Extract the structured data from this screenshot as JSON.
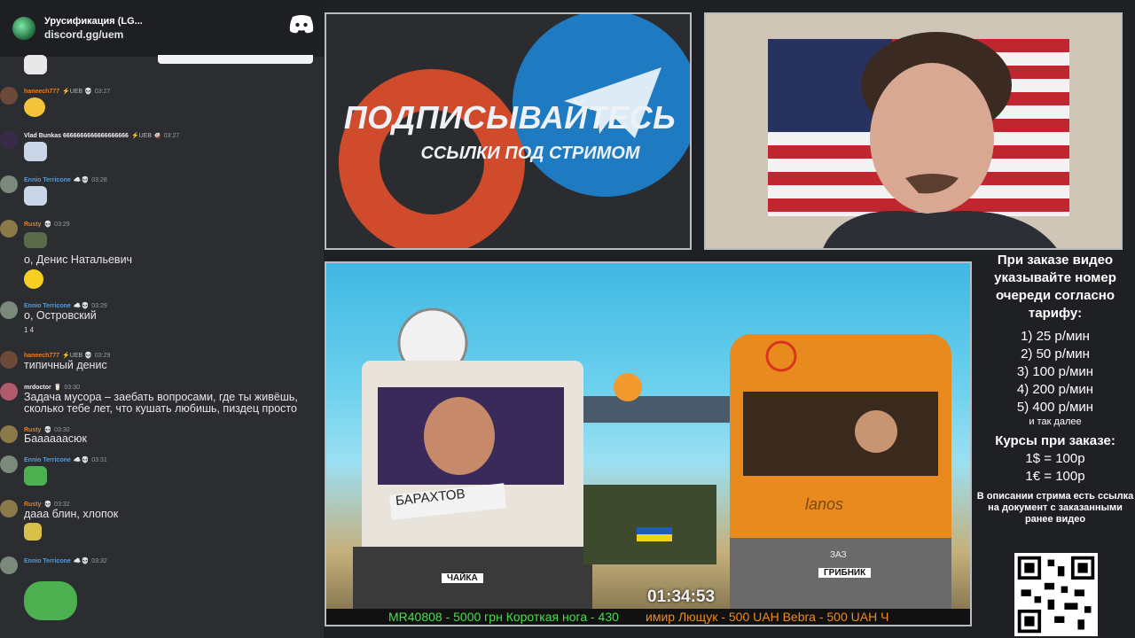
{
  "discord": {
    "server_name": "Урусификация (LG...",
    "invite": "discord.gg/uem"
  },
  "chat": [
    {
      "user": "haneech777",
      "badge": "⚡UEB 💀",
      "time": "03:27",
      "name_color": "#e67e22",
      "text": ""
    },
    {
      "user": "Vlad Bunkas 6666666666666666666",
      "badge": "⚡UEB 🥥",
      "time": "03:27",
      "name_color": "#f0f0f0",
      "text": ""
    },
    {
      "user": "Ennio Terricone",
      "badge": "☁️💀",
      "time": "03:28",
      "name_color": "#5b9bd5",
      "text": ""
    },
    {
      "user": "Rusty",
      "badge": "💀",
      "time": "03:29",
      "name_color": "#e67e22",
      "text": "о, Денис Натальевич"
    },
    {
      "user": "Ennio Terricone",
      "badge": "☁️💀",
      "time": "03:29",
      "name_color": "#5b9bd5",
      "text": "о, Островский",
      "reactions": "1  4"
    },
    {
      "user": "haneech777",
      "badge": "⚡UEB 💀",
      "time": "03:29",
      "name_color": "#e67e22",
      "text": "типичный денис"
    },
    {
      "user": "mrdoctor",
      "badge": "🥛",
      "time": "03:30",
      "name_color": "#f0f0f0",
      "text": "Задача мусора – заебать вопросами, где ты живёшь,",
      "text2": "сколько тебе лет, что кушать любишь, пиздец просто"
    },
    {
      "user": "Rusty",
      "badge": "💀",
      "time": "03:30",
      "name_color": "#e67e22",
      "text": "Баааааасюк"
    },
    {
      "user": "Ennio Terricone",
      "badge": "☁️💀",
      "time": "03:31",
      "name_color": "#5b9bd5",
      "text": ""
    },
    {
      "user": "Rusty",
      "badge": "💀",
      "time": "03:32",
      "name_color": "#e67e22",
      "text": "дааа блин, хлопок"
    },
    {
      "user": "Ennio Terricone",
      "badge": "☁️💀",
      "time": "03:32",
      "name_color": "#5b9bd5",
      "text": ""
    }
  ],
  "promo": {
    "headline": "ПОДПИСЫВАЙТЕСЬ",
    "subline": "ССЫЛКИ ПОД СТРИМОМ"
  },
  "video": {
    "timer": "01:34:53",
    "ticker_green": "MR40808 - 5000 грн  Короткая нога - 430",
    "ticker_orange": "имир Лющук - 500 UAH    Bebra - 500 UAH   Ч",
    "sign_left": "БАРАХТОВ",
    "plate_left": "ЧАЙКА",
    "plate_right": "ГРИБНИК",
    "bus_brand": "lanos",
    "bus_badge": "ЗАЗ"
  },
  "info": {
    "order_note": "При заказе видео указывайте номер очереди согласно тарифу:",
    "tariffs": [
      "1) 25 р/мин",
      "2) 50 р/мин",
      "3) 100 р/мин",
      "4) 200 р/мин",
      "5) 400 р/мин"
    ],
    "etc": "и так далее",
    "rates_title": "Курсы при заказе:",
    "rate_usd": "1$ = 100р",
    "rate_eur": "1€ = 100р",
    "description_note": "В описании стрима есть ссылка на документ с заказанными ранее видео"
  }
}
